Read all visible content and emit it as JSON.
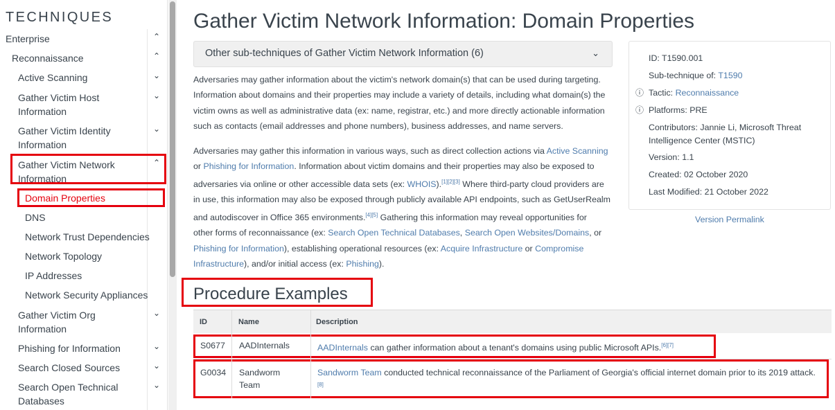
{
  "sidebar": {
    "title": "TECHNIQUES",
    "items": [
      {
        "label": "Enterprise",
        "chevron": "^"
      },
      {
        "label": "Reconnaissance",
        "chevron": "^"
      },
      {
        "label": "Active Scanning",
        "chevron": "v"
      },
      {
        "label": "Gather Victim Host",
        "label2": "Information",
        "chevron": "v"
      },
      {
        "label": "Gather Victim Identity",
        "label2": "Information",
        "chevron": "v"
      },
      {
        "label": "Gather Victim Network",
        "label2": "Information",
        "chevron": "^"
      },
      {
        "label": "Domain Properties"
      },
      {
        "label": "DNS"
      },
      {
        "label": "Network Trust Dependencies"
      },
      {
        "label": "Network Topology"
      },
      {
        "label": "IP Addresses"
      },
      {
        "label": "Network Security Appliances"
      },
      {
        "label": "Gather Victim Org",
        "label2": "Information",
        "chevron": "v"
      },
      {
        "label": "Phishing for Information",
        "chevron": "v"
      },
      {
        "label": "Search Closed Sources",
        "chevron": "v"
      },
      {
        "label": "Search Open Technical",
        "label2": "Databases",
        "chevron": "v"
      }
    ]
  },
  "main": {
    "title": "Gather Victim Network Information: Domain Properties",
    "subtech_label": "Other sub-techniques of Gather Victim Network Information (6)",
    "para1": [
      "Adversaries may gather information about the victim's network domain(s) that can be used during targeting.",
      "Information about domains and their properties may include a variety of details, including what domain(s) the",
      "victim owns as well as administrative data (ex: name, registrar, etc.) and more directly actionable information",
      "such as contacts (email addresses and phone numbers), business addresses, and name servers."
    ],
    "para2": {
      "l1a": "Adversaries may gather this information in various ways, such as direct collection actions via ",
      "l1link": "Active Scanning",
      "l2a": "or ",
      "l2link": "Phishing for Information",
      "l2b": ". Information about victim domains and their properties may also be exposed to",
      "l3a": "adversaries via online or other accessible data sets (ex: ",
      "l3link": "WHOIS",
      "l3b": ").",
      "l3sup": "[1][2][3]",
      "l3c": " Where third-party cloud providers are",
      "l4": "in use, this information may also be exposed through publicly available API endpoints, such as GetUserRealm",
      "l5a": "and autodiscover in Office 365 environments.",
      "l5sup": "[4][5]",
      "l5b": " Gathering this information may reveal opportunities for",
      "l6a": "other forms of reconnaissance (ex: ",
      "l6link1": "Search Open Technical Databases",
      "l6b": ", ",
      "l6link2": "Search Open Websites/Domains",
      "l6c": ", or",
      "l7link1": "Phishing for Information",
      "l7a": "), establishing operational resources (ex: ",
      "l7link2": "Acquire Infrastructure",
      "l7b": " or ",
      "l7link3": "Compromise",
      "l8link": "Infrastructure",
      "l8a": "), and/or initial access (ex: ",
      "l8link2": "Phishing",
      "l8b": ")."
    },
    "procedure_title": "Procedure Examples"
  },
  "card": {
    "id": "ID: T1590.001",
    "subtech_prefix": "Sub-technique of: ",
    "subtech_link": "T1590",
    "tactic_prefix": "Tactic: ",
    "tactic_link": "Reconnaissance",
    "platforms": "Platforms: PRE",
    "contributors1": "Contributors: Jannie Li, Microsoft Threat",
    "contributors2": "Intelligence Center (MSTIC)",
    "version": "Version: 1.1",
    "created": "Created: 02 October 2020",
    "modified": "Last Modified: 21 October 2022",
    "permalink": "Version Permalink",
    "info_icon": "ⓘ"
  },
  "table": {
    "headers": [
      "ID",
      "Name",
      "Description"
    ],
    "rows": [
      {
        "id": "S0677",
        "name": "AADInternals",
        "name2": "",
        "desc_link": "AADInternals",
        "desc": " can gather information about a tenant's domains using public Microsoft APIs.",
        "sup": "[6][7]"
      },
      {
        "id": "G0034",
        "name": "Sandworm",
        "name2": "Team",
        "desc_link": "Sandworm Team",
        "desc": " conducted technical reconnaissance of the Parliament of Georgia's official internet domain prior to its 2019 attack.",
        "sup": "[8]"
      }
    ]
  },
  "colors": {
    "link": "#4f7cac",
    "highlight": "#e5000d",
    "text": "#39434c"
  }
}
